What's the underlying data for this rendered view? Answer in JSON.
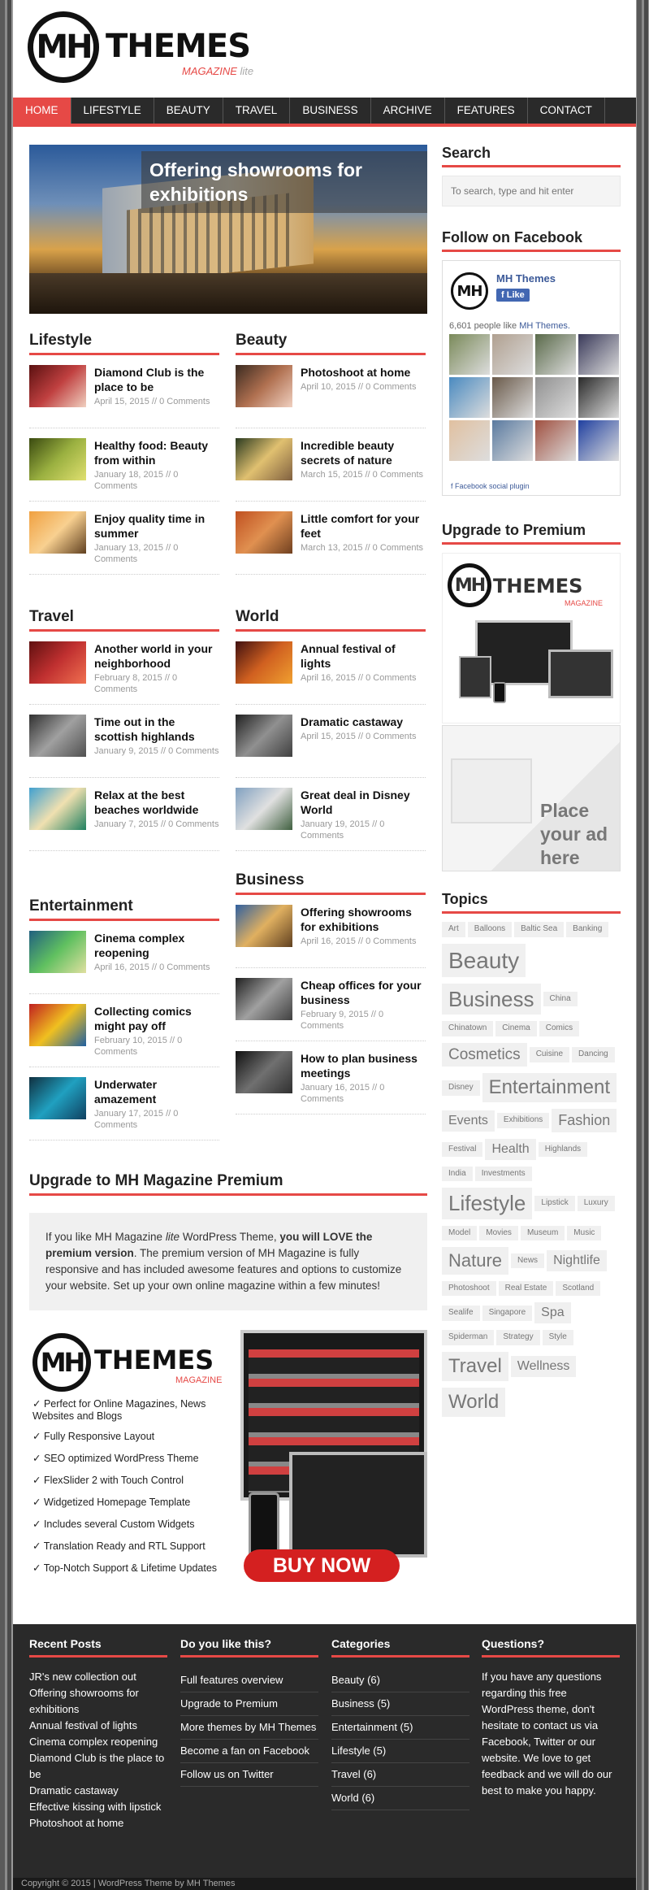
{
  "header": {
    "logo_mark": "MH",
    "logo_text": "THEMES",
    "logo_sub": "MAGAZINE",
    "logo_sub_lite": "lite"
  },
  "nav": [
    "HOME",
    "LIFESTYLE",
    "BEAUTY",
    "TRAVEL",
    "BUSINESS",
    "ARCHIVE",
    "FEATURES",
    "CONTACT"
  ],
  "slider": {
    "caption": "Offering showrooms for exhibitions"
  },
  "sections": {
    "lifestyle": {
      "title": "Lifestyle",
      "posts": [
        {
          "title": "Diamond Club is the place to be",
          "meta": "April 15, 2015 // 0 Comments"
        },
        {
          "title": "Healthy food: Beauty from within",
          "meta": "January 18, 2015 // 0 Comments"
        },
        {
          "title": "Enjoy quality time in summer",
          "meta": "January 13, 2015 // 0 Comments"
        }
      ]
    },
    "beauty": {
      "title": "Beauty",
      "posts": [
        {
          "title": "Photoshoot at home",
          "meta": "April 10, 2015 // 0 Comments"
        },
        {
          "title": "Incredible beauty secrets of nature",
          "meta": "March 15, 2015 // 0 Comments"
        },
        {
          "title": "Little comfort for your feet",
          "meta": "March 13, 2015 // 0 Comments"
        }
      ]
    },
    "travel": {
      "title": "Travel",
      "posts": [
        {
          "title": "Another world in your neighborhood",
          "meta": "February 8, 2015 // 0 Comments"
        },
        {
          "title": "Time out in the scottish highlands",
          "meta": "January 9, 2015 // 0 Comments"
        },
        {
          "title": "Relax at the best beaches worldwide",
          "meta": "January 7, 2015 // 0 Comments"
        }
      ]
    },
    "world": {
      "title": "World",
      "posts": [
        {
          "title": "Annual festival of lights",
          "meta": "April 16, 2015 // 0 Comments"
        },
        {
          "title": "Dramatic castaway",
          "meta": "April 15, 2015 // 0 Comments"
        },
        {
          "title": "Great deal in Disney World",
          "meta": "January 19, 2015 // 0 Comments"
        }
      ]
    },
    "entertainment": {
      "title": "Entertainment",
      "posts": [
        {
          "title": "Cinema complex reopening",
          "meta": "April 16, 2015 // 0 Comments"
        },
        {
          "title": "Collecting comics might pay off",
          "meta": "February 10, 2015 // 0 Comments"
        },
        {
          "title": "Underwater amazement",
          "meta": "January 17, 2015 // 0 Comments"
        }
      ]
    },
    "business": {
      "title": "Business",
      "posts": [
        {
          "title": "Offering showrooms for exhibitions",
          "meta": "April 16, 2015 // 0 Comments"
        },
        {
          "title": "Cheap offices for your business",
          "meta": "February 9, 2015 // 0 Comments"
        },
        {
          "title": "How to plan business meetings",
          "meta": "January 16, 2015 // 0 Comments"
        }
      ]
    }
  },
  "upgrade": {
    "title": "Upgrade to MH Magazine Premium",
    "text_1": "If you like MH Magazine ",
    "text_lite": "lite",
    "text_2": " WordPress Theme, ",
    "text_bold": "you will LOVE the premium version",
    "text_3": ". The premium version of MH Magazine is fully responsive and has included awesome features and options to customize your website. Set up your own online magazine within a few minutes!",
    "promo_mark": "MH",
    "promo_text": "THEMES",
    "promo_mag": "MAGAZINE",
    "features": [
      "✓ Perfect for Online Magazines, News Websites and Blogs",
      "✓ Fully Responsive Layout",
      "✓ SEO optimized WordPress Theme",
      "✓ FlexSlider 2 with Touch Control",
      "✓ Widgetized Homepage Template",
      "✓ Includes several Custom Widgets",
      "✓ Translation Ready and RTL Support",
      "✓ Top-Notch Support & Lifetime Updates"
    ],
    "buy_label": "BUY NOW"
  },
  "sidebar": {
    "search_title": "Search",
    "search_placeholder": "To search, type and hit enter",
    "facebook_title": "Follow on Facebook",
    "fb_name": "MH Themes",
    "fb_like": "Like",
    "fb_count": "6,601 people like ",
    "fb_count_name": "MH Themes.",
    "fb_plugin": "Facebook social plugin",
    "premium_title": "Upgrade to Premium",
    "ad_text": "Place your ad here",
    "topics_title": "Topics",
    "tags": [
      {
        "t": "Art",
        "s": 10
      },
      {
        "t": "Balloons",
        "s": 10
      },
      {
        "t": "Baltic Sea",
        "s": 10
      },
      {
        "t": "Banking",
        "s": 10
      },
      {
        "t": "Beauty",
        "s": 28
      },
      {
        "t": "Business",
        "s": 26
      },
      {
        "t": "China",
        "s": 10
      },
      {
        "t": "Chinatown",
        "s": 10
      },
      {
        "t": "Cinema",
        "s": 10
      },
      {
        "t": "Comics",
        "s": 10
      },
      {
        "t": "Cosmetics",
        "s": 19
      },
      {
        "t": "Cuisine",
        "s": 10
      },
      {
        "t": "Dancing",
        "s": 10
      },
      {
        "t": "Disney",
        "s": 10
      },
      {
        "t": "Entertainment",
        "s": 24
      },
      {
        "t": "Events",
        "s": 16
      },
      {
        "t": "Exhibitions",
        "s": 10
      },
      {
        "t": "Fashion",
        "s": 18
      },
      {
        "t": "Festival",
        "s": 10
      },
      {
        "t": "Health",
        "s": 16
      },
      {
        "t": "Highlands",
        "s": 10
      },
      {
        "t": "India",
        "s": 10
      },
      {
        "t": "Investments",
        "s": 10
      },
      {
        "t": "Lifestyle",
        "s": 26
      },
      {
        "t": "Lipstick",
        "s": 10
      },
      {
        "t": "Luxury",
        "s": 10
      },
      {
        "t": "Model",
        "s": 10
      },
      {
        "t": "Movies",
        "s": 10
      },
      {
        "t": "Museum",
        "s": 10
      },
      {
        "t": "Music",
        "s": 10
      },
      {
        "t": "Nature",
        "s": 22
      },
      {
        "t": "News",
        "s": 10
      },
      {
        "t": "Nightlife",
        "s": 16
      },
      {
        "t": "Photoshoot",
        "s": 10
      },
      {
        "t": "Real Estate",
        "s": 10
      },
      {
        "t": "Scotland",
        "s": 10
      },
      {
        "t": "Sealife",
        "s": 10
      },
      {
        "t": "Singapore",
        "s": 10
      },
      {
        "t": "Spa",
        "s": 16
      },
      {
        "t": "Spiderman",
        "s": 10
      },
      {
        "t": "Strategy",
        "s": 10
      },
      {
        "t": "Style",
        "s": 10
      },
      {
        "t": "Travel",
        "s": 24
      },
      {
        "t": "Wellness",
        "s": 16
      },
      {
        "t": "World",
        "s": 24
      }
    ]
  },
  "footer": {
    "recent_title": "Recent Posts",
    "recent": [
      "JR's new collection out",
      "Offering showrooms for exhibitions",
      "Annual festival of lights",
      "Cinema complex reopening",
      "Diamond Club is the place to be",
      "Dramatic castaway",
      "Effective kissing with lipstick",
      "Photoshoot at home"
    ],
    "like_title": "Do you like this?",
    "like": [
      "Full features overview",
      "Upgrade to Premium",
      "More themes by MH Themes",
      "Become a fan on Facebook",
      "Follow us on Twitter"
    ],
    "cat_title": "Categories",
    "cats": [
      "Beauty (6)",
      "Business (5)",
      "Entertainment (5)",
      "Lifestyle (5)",
      "Travel (6)",
      "World (6)"
    ],
    "q_title": "Questions?",
    "q_text": "If you have any questions regarding this free WordPress theme, don't hesitate to contact us via Facebook, Twitter or our website. We love to get feedback and we will do our best to make you happy.",
    "copyright": "Copyright © 2015 | WordPress Theme by MH Themes"
  }
}
